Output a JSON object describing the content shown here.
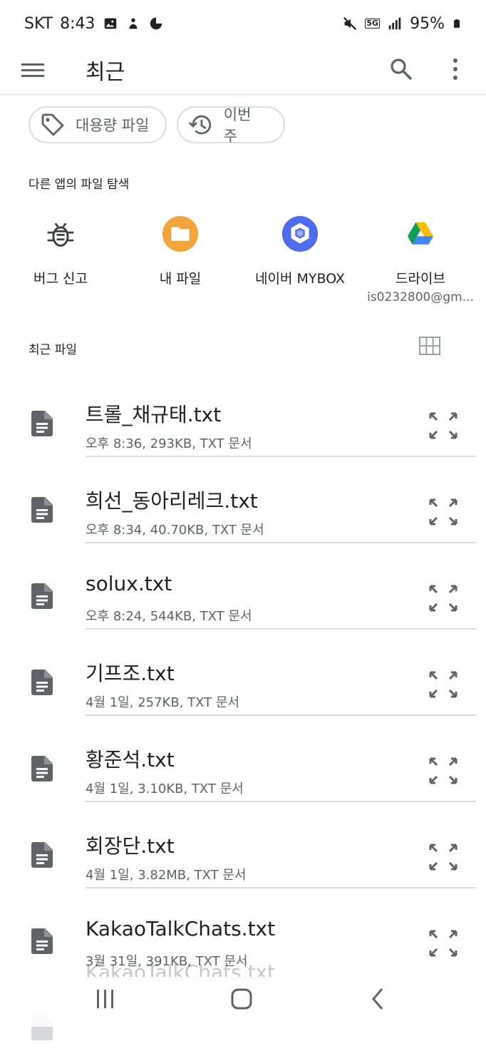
{
  "status_bar": {
    "carrier": "SKT",
    "time": "8:43",
    "network": "5G",
    "battery": "95%"
  },
  "app_bar": {
    "title": "최근"
  },
  "chips": [
    {
      "label": "대용량 파일",
      "icon": "tag-icon"
    },
    {
      "label": "이번 주",
      "icon": "history-icon"
    }
  ],
  "other_apps": {
    "heading": "다른 앱의 파일 탐색",
    "apps": [
      {
        "label": "버그 신고",
        "sub": "",
        "icon": "bug-icon"
      },
      {
        "label": "내 파일",
        "sub": "",
        "icon": "folder-icon"
      },
      {
        "label": "네이버 MYBOX",
        "sub": "",
        "icon": "mybox-icon"
      },
      {
        "label": "드라이브",
        "sub": "is0232800@gm...",
        "icon": "google-drive-icon"
      }
    ]
  },
  "recent_files": {
    "heading": "최근 파일",
    "files": [
      {
        "name": "트롤_채규태.txt",
        "meta": "오후 8:36, 293KB, TXT 문서"
      },
      {
        "name": "희선_동아리레크.txt",
        "meta": "오후 8:34, 40.70KB, TXT 문서"
      },
      {
        "name": "solux.txt",
        "meta": "오후 8:24, 544KB, TXT 문서"
      },
      {
        "name": "기프조.txt",
        "meta": "4월 1일, 257KB, TXT 문서"
      },
      {
        "name": "황준석.txt",
        "meta": "4월 1일, 3.10KB, TXT 문서"
      },
      {
        "name": "회장단.txt",
        "meta": "4월 1일, 3.82MB, TXT 문서"
      },
      {
        "name": "KakaoTalkChats.txt",
        "meta": "3월 31일, 391KB, TXT 문서"
      },
      {
        "name": "KakaoTalkChats.txt",
        "meta": ""
      }
    ]
  },
  "colors": {
    "accent_orange": "#F2A53B",
    "mybox_blue": "#4D6CF0",
    "icon_gray": "#5f6368",
    "divider": "#dadce0"
  }
}
